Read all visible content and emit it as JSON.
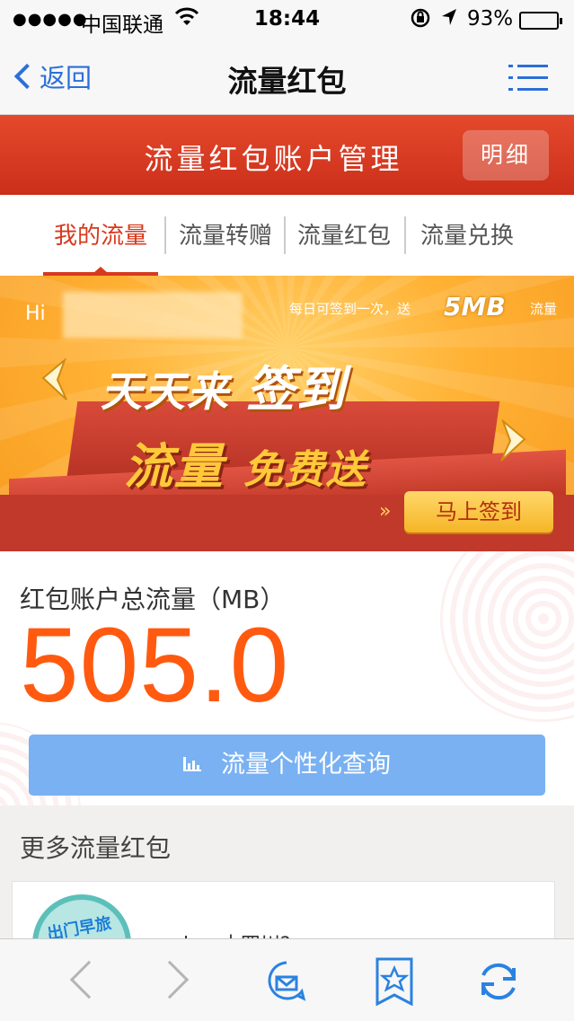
{
  "status_bar": {
    "signal": "●●●●●",
    "carrier": "中国联通",
    "time": "18:44",
    "battery_percent": "93%",
    "battery_level": 0.93
  },
  "nav": {
    "back_label": "返回",
    "title": "流量红包"
  },
  "header": {
    "title": "流量红包账户管理",
    "detail_button": "明细"
  },
  "tabs": [
    {
      "label": "我的流量",
      "active": true
    },
    {
      "label": "流量转赠",
      "active": false
    },
    {
      "label": "流量红包",
      "active": false
    },
    {
      "label": "流量兑换",
      "active": false
    }
  ],
  "banner": {
    "greeting": "Hi",
    "daily_note": "每日可签到一次，送",
    "bonus": "5MB",
    "bonus_unit": "流量",
    "headline_a": "天天来",
    "headline_b": "签到",
    "subline_a": "流量",
    "subline_b": "免费送",
    "button": "马上签到"
  },
  "account": {
    "label": "红包账户总流量（MB）",
    "value": "505.0",
    "query_button": "流量个性化查询"
  },
  "more": {
    "title": "更多流量红包",
    "thumb_text": "出门早旅",
    "card_text": "h... 小四川?"
  },
  "toolbar": {
    "icons": [
      "back-arrow-icon",
      "forward-arrow-icon",
      "mail-icon",
      "bookmark-star-icon",
      "refresh-icon"
    ]
  },
  "colors": {
    "accent_blue": "#2b6fd8",
    "header_red": "#d7391e",
    "value_orange": "#ff5a0f",
    "query_blue": "#79b1f2"
  }
}
